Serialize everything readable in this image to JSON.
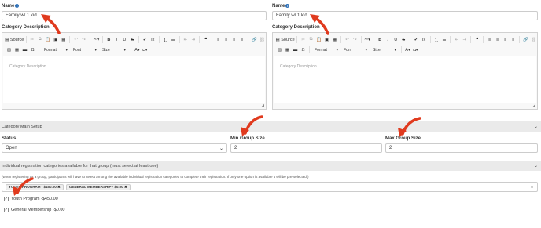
{
  "name_label": "Name",
  "left": {
    "name_value": "Family w/ 1 kid",
    "desc_label": "Category Description",
    "placeholder": "Category Description"
  },
  "right": {
    "name_value": "Family w/ 1 kid",
    "desc_label": "Category Description",
    "placeholder": "Category Description"
  },
  "toolbar": {
    "source": "Source",
    "format": "Format",
    "font": "Font",
    "size": "Size"
  },
  "section_main": "Category Main Setup",
  "status": {
    "label": "Status",
    "value": "Open"
  },
  "min_group": {
    "label": "Min Group Size",
    "value": "2"
  },
  "max_group": {
    "label": "Max Group Size",
    "value": "2"
  },
  "section_reg": "Individual registration categories available for that group (must select at least one)",
  "reg_note": "(when registering as a group, participants will have to select among the available individual registration categories to complete their registration. If only one option is available it will be pre-selected.)",
  "tags": [
    "YOUTH PROGRAM - $450.00",
    "GENERAL MEMBERSHIP - $0.00"
  ],
  "options": [
    "Youth Program -$450.00",
    "General Membership -$0.00"
  ],
  "colors": {
    "arrow": "#e03a1e",
    "band": "#eaeaea",
    "info": "#2a6db5"
  }
}
